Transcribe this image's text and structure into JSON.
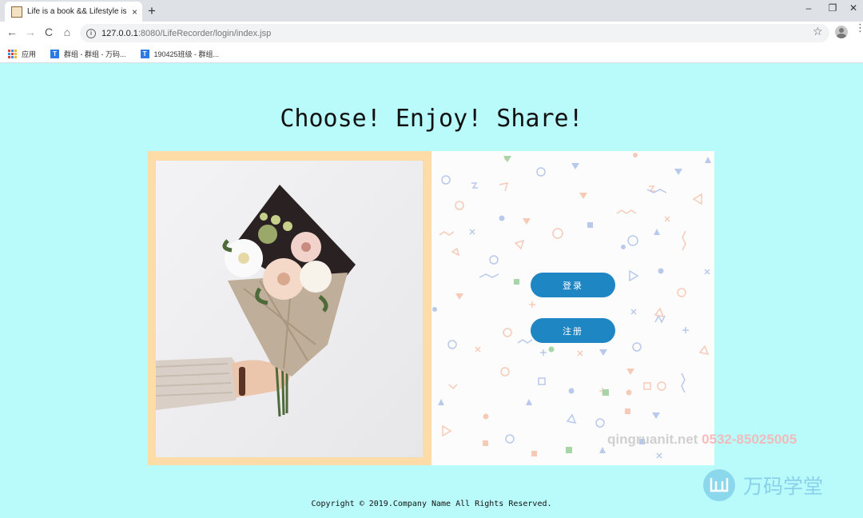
{
  "browser": {
    "tab_title": "Life is a book && Lifestyle is a...",
    "tab_close": "×",
    "new_tab": "+",
    "window": {
      "minimize": "–",
      "maximize": "❐",
      "close": "✕"
    },
    "nav": {
      "back": "←",
      "forward": "→",
      "reload": "C",
      "home": "⌂"
    },
    "url_host": "127.0.0.1",
    "url_rest": ":8080/LifeRecorder/login/index.jsp",
    "info_glyph": "i",
    "star": "☆",
    "menu": "⋮",
    "bookmarks": [
      {
        "label": "应用",
        "icon": "apps-icon"
      },
      {
        "label": "群组 - 群组 - 万码...",
        "icon": "tab-icon"
      },
      {
        "label": "190425班级 - 群组...",
        "icon": "tab-icon"
      }
    ]
  },
  "page": {
    "headline": "Choose! Enjoy! Share!",
    "login_button": "登录",
    "register_button": "注册",
    "footer": "Copyright © 2019.Company Name All Rights Reserved."
  },
  "watermark": {
    "site": "qingruanit.net",
    "phone": "0532-85025005",
    "brand": "万码学堂"
  },
  "colors": {
    "background": "#b9fbfa",
    "photo_frame": "#fddca7",
    "button": "#1f86c4"
  }
}
